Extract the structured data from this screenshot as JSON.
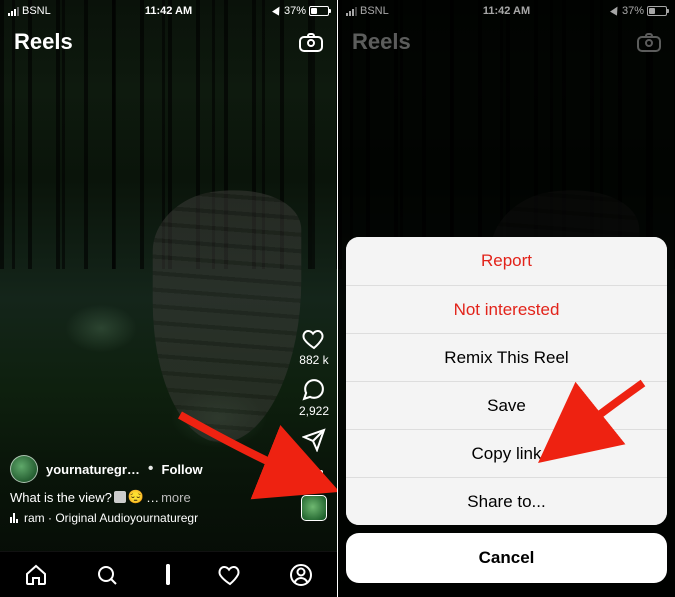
{
  "status": {
    "carrier": "BSNL",
    "time": "11:42 AM",
    "battery_pct": "37%"
  },
  "header": {
    "title": "Reels"
  },
  "actions": {
    "like_count": "882 k",
    "comment_count": "2,922"
  },
  "meta": {
    "username": "yournaturegr…",
    "follow": "Follow",
    "caption": "What is the view?",
    "more": "more",
    "audio": "ram · Original Audioyournaturegr"
  },
  "sheet": {
    "report": "Report",
    "not_interested": "Not interested",
    "remix": "Remix This Reel",
    "save": "Save",
    "copy_link": "Copy link",
    "share_to": "Share to...",
    "cancel": "Cancel"
  }
}
